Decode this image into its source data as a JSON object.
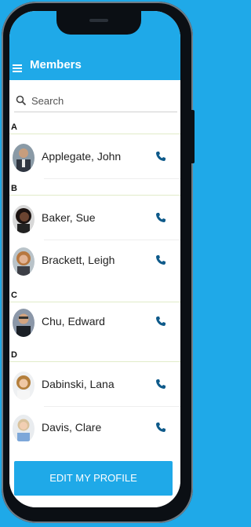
{
  "app": {
    "title": "Members"
  },
  "search": {
    "placeholder": "Search"
  },
  "sections": [
    {
      "letter": "A"
    },
    {
      "letter": "B"
    },
    {
      "letter": "C"
    },
    {
      "letter": "D"
    }
  ],
  "members": [
    {
      "name": "Applegate, John"
    },
    {
      "name": "Baker, Sue"
    },
    {
      "name": "Brackett, Leigh"
    },
    {
      "name": "Chu, Edward"
    },
    {
      "name": "Dabinski, Lana"
    },
    {
      "name": "Davis, Clare"
    }
  ],
  "footer": {
    "edit_label": "EDIT MY PROFILE"
  },
  "icons": {
    "menu": "hamburger-icon",
    "search": "search-icon",
    "call": "phone-icon"
  },
  "colors": {
    "accent": "#1FA9E8",
    "icon": "#0E5A8A"
  }
}
